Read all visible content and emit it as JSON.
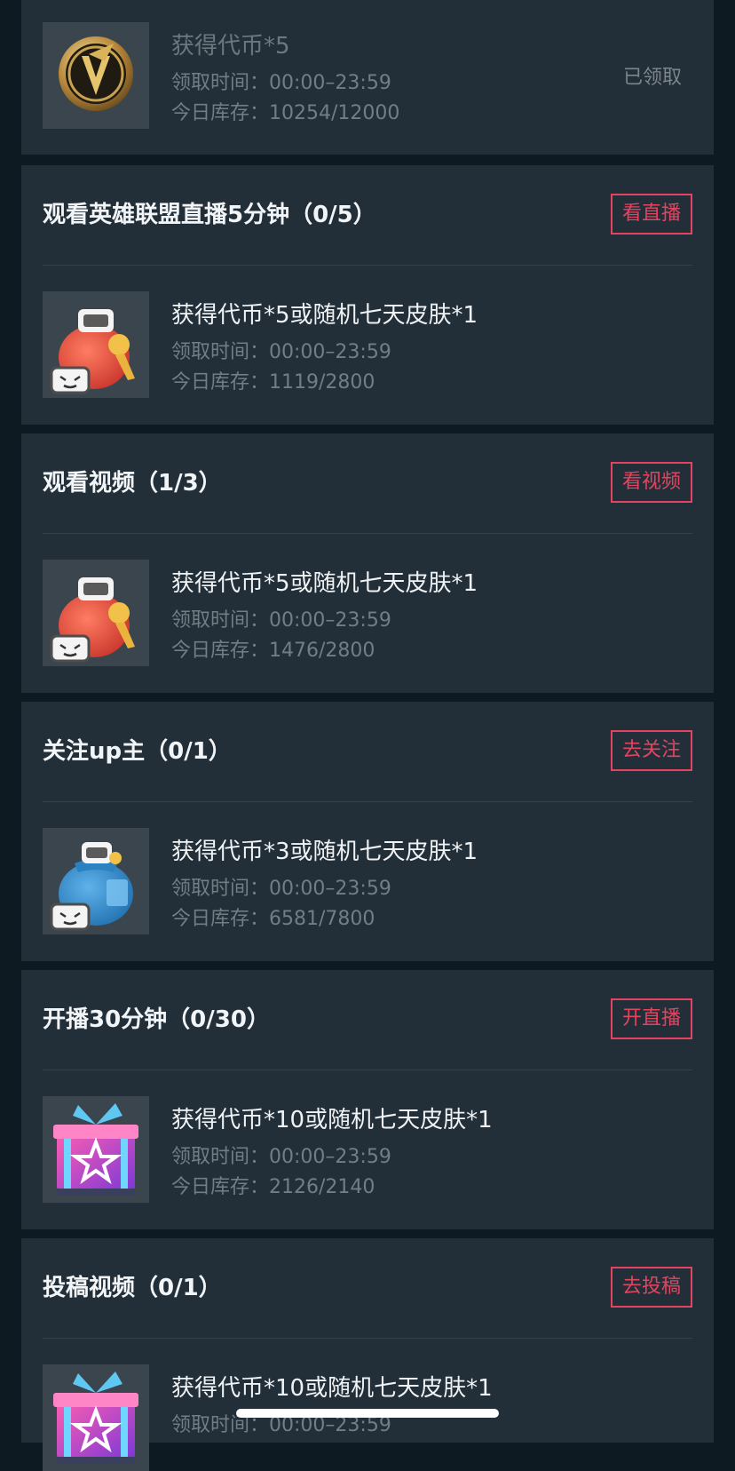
{
  "reward_labels": {
    "time_prefix": "领取时间：",
    "stock_prefix": "今日库存："
  },
  "first_card": {
    "reward": {
      "icon": "lol-coin-emblem-icon",
      "name": "获得代币*5",
      "time": "00:00–23:59",
      "stock": "10254/12000",
      "status": "已领取"
    }
  },
  "tasks": [
    {
      "title": "观看英雄联盟直播5分钟（0/5）",
      "button": "看直播",
      "reward": {
        "icon": "red-lucky-bag-icon",
        "name": "获得代币*5或随机七天皮肤*1",
        "time": "00:00–23:59",
        "stock": "1119/2800"
      }
    },
    {
      "title": "观看视频（1/3）",
      "button": "看视频",
      "reward": {
        "icon": "red-lucky-bag-icon",
        "name": "获得代币*5或随机七天皮肤*1",
        "time": "00:00–23:59",
        "stock": "1476/2800"
      }
    },
    {
      "title": "关注up主（0/1）",
      "button": "去关注",
      "reward": {
        "icon": "blue-lucky-bag-icon",
        "name": "获得代币*3或随机七天皮肤*1",
        "time": "00:00–23:59",
        "stock": "6581/7800"
      }
    },
    {
      "title": "开播30分钟（0/30）",
      "button": "开直播",
      "reward": {
        "icon": "star-gift-box-icon",
        "name": "获得代币*10或随机七天皮肤*1",
        "time": "00:00–23:59",
        "stock": "2126/2140"
      }
    },
    {
      "title": "投稿视频（0/1）",
      "button": "去投稿",
      "reward": {
        "icon": "star-gift-box-icon",
        "name": "获得代币*10或随机七天皮肤*1",
        "time": "00:00–23:59",
        "stock": ""
      }
    }
  ],
  "colors": {
    "background": "#0d1a21",
    "card": "#232f38",
    "accent": "#e4445f",
    "muted_text": "#727d85"
  }
}
